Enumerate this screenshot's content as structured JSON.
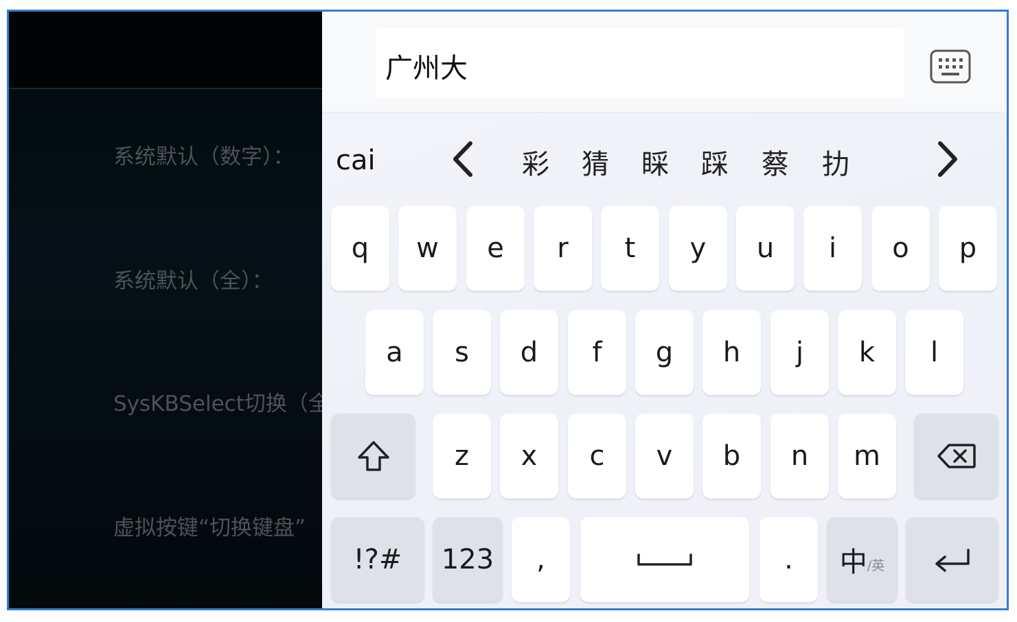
{
  "settings": {
    "items": [
      {
        "label": "系统默认（数字）："
      },
      {
        "label": "系统默认（全）："
      },
      {
        "label": "SysKBSelect切换（全"
      },
      {
        "label": "虚拟按键“切换键盘”"
      }
    ]
  },
  "input": {
    "value": "广州大"
  },
  "candidates": {
    "pinyin": "cai",
    "items": [
      "彩",
      "猜",
      "睬",
      "踩",
      "蔡",
      "扐"
    ]
  },
  "keyboard": {
    "row1": [
      "q",
      "w",
      "e",
      "r",
      "t",
      "y",
      "u",
      "i",
      "o",
      "p"
    ],
    "row2": [
      "a",
      "s",
      "d",
      "f",
      "g",
      "h",
      "j",
      "k",
      "l"
    ],
    "row3": [
      "z",
      "x",
      "c",
      "v",
      "b",
      "n",
      "m"
    ],
    "symbols_label": "!?#",
    "numbers_label": "123",
    "comma_label": ",",
    "period_label": ".",
    "lang_main": "中",
    "lang_sub": "/英"
  },
  "icons": {
    "keyboard_toggle": "keyboard-icon",
    "shift": "shift-arrow-icon",
    "backspace": "backspace-icon",
    "enter": "enter-arrow-icon",
    "space": "space-bar-icon"
  },
  "colors": {
    "frame_border": "#2f7fcf",
    "function_key": "#dfe1e9",
    "key": "#ffffff"
  }
}
